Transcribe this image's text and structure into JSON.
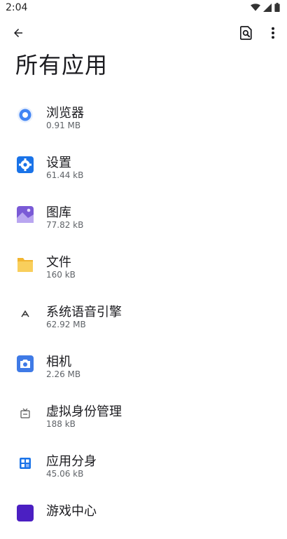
{
  "status": {
    "time": "2:04",
    "icons": [
      "wifi-icon",
      "cell-signal-icon",
      "battery-icon"
    ]
  },
  "toolbar": {
    "back_icon": "arrow-back-icon",
    "search_icon": "search-document-icon",
    "more_icon": "more-vert-icon"
  },
  "page": {
    "title": "所有应用"
  },
  "apps": [
    {
      "name": "浏览器",
      "size": "0.91 MB",
      "icon": "browser-icon"
    },
    {
      "name": "设置",
      "size": "61.44 kB",
      "icon": "settings-icon"
    },
    {
      "name": "图库",
      "size": "77.82 kB",
      "icon": "gallery-icon"
    },
    {
      "name": "文件",
      "size": "160 kB",
      "icon": "folder-icon"
    },
    {
      "name": "系统语音引擎",
      "size": "62.92 MB",
      "icon": "tts-engine-icon"
    },
    {
      "name": "相机",
      "size": "2.26 MB",
      "icon": "camera-icon"
    },
    {
      "name": "虚拟身份管理",
      "size": "188 kB",
      "icon": "virtual-identity-icon"
    },
    {
      "name": "应用分身",
      "size": "45.06 kB",
      "icon": "app-clone-icon"
    },
    {
      "name": "游戏中心",
      "size": "",
      "icon": "game-center-icon"
    }
  ],
  "colors": {
    "browser": "#1a73e8",
    "settings": "#1a73e8",
    "gallery": "#7a5ad6",
    "folder": "#f2b530",
    "camera": "#3f7ae6",
    "clone": "#1a73e8",
    "game": "#4b1fc2"
  }
}
